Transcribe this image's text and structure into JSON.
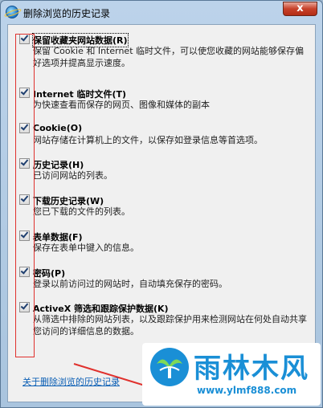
{
  "window": {
    "title": "删除浏览的历史记录",
    "close_label": "x"
  },
  "options": [
    {
      "title": "保留收藏夹网站数据(R)",
      "desc": "保留 Cookie 和 Internet 临时文件，可以使您收藏的网站能够保存偏好选项并提高显示速度。",
      "checked": true
    },
    {
      "title": "Internet 临时文件(T)",
      "desc": "为快速查看而保存的网页、图像和媒体的副本",
      "checked": true
    },
    {
      "title": "Cookie(O)",
      "desc": "网站存储在计算机上的文件，以保存如登录信息等首选项。",
      "checked": true
    },
    {
      "title": "历史记录(H)",
      "desc": "已访问网站的列表。",
      "checked": true
    },
    {
      "title": "下载历史记录(W)",
      "desc": "您已下载的文件的列表。",
      "checked": true
    },
    {
      "title": "表单数据(F)",
      "desc": "保存在表单中键入的信息。",
      "checked": true
    },
    {
      "title": "密码(P)",
      "desc": "登录以前访问过的网站时，自动填充保存的密码。",
      "checked": true
    },
    {
      "title": "ActiveX 筛选和跟踪保护数据(K)",
      "desc": "从筛选中排除的网站列表，以及跟踪保护用来检测网站在何处自动共享您访问的详细信息的数据。",
      "checked": true
    }
  ],
  "link": {
    "text": "关于删除浏览的历史记录"
  },
  "watermark": {
    "title": "雨林木风",
    "url": "www.ylmf888.com"
  },
  "colors": {
    "annotation_red": "#e0312d",
    "link_blue": "#0b5fb5",
    "watermark_blue": "#1a8fd6"
  }
}
